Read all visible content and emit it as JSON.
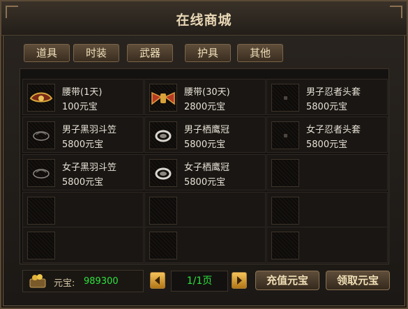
{
  "window": {
    "title": "在线商城",
    "close_icon": "close-icon"
  },
  "tabs": [
    {
      "label": "道具"
    },
    {
      "label": "时装"
    },
    {
      "label": "武器"
    },
    {
      "label": "护具"
    },
    {
      "label": "其他"
    }
  ],
  "items": [
    {
      "name": "腰带(1天)",
      "price": "100元宝",
      "icon": "red-gold-belt-icon"
    },
    {
      "name": "腰带(30天)",
      "price": "2800元宝",
      "icon": "red-winged-belt-icon"
    },
    {
      "name": "男子忍者头套",
      "price": "5800元宝",
      "icon": "ninja-hood-icon"
    },
    {
      "name": "男子黑羽斗笠",
      "price": "5800元宝",
      "icon": "black-feather-hat-icon"
    },
    {
      "name": "男子栖鹰冠",
      "price": "5800元宝",
      "icon": "eagle-crown-icon"
    },
    {
      "name": "女子忍者头套",
      "price": "5800元宝",
      "icon": "ninja-hood-icon"
    },
    {
      "name": "女子黑羽斗笠",
      "price": "5800元宝",
      "icon": "black-feather-hat-icon"
    },
    {
      "name": "女子栖鹰冠",
      "price": "5800元宝",
      "icon": "eagle-crown-icon"
    }
  ],
  "footer": {
    "currency_label": "元宝:",
    "currency_value": "989300",
    "page": "1/1页",
    "recharge_label": "充值元宝",
    "claim_label": "领取元宝"
  },
  "colors": {
    "accent_green": "#2ee33c",
    "text_gold": "#f1dfb6",
    "panel_bg": "#141210"
  }
}
